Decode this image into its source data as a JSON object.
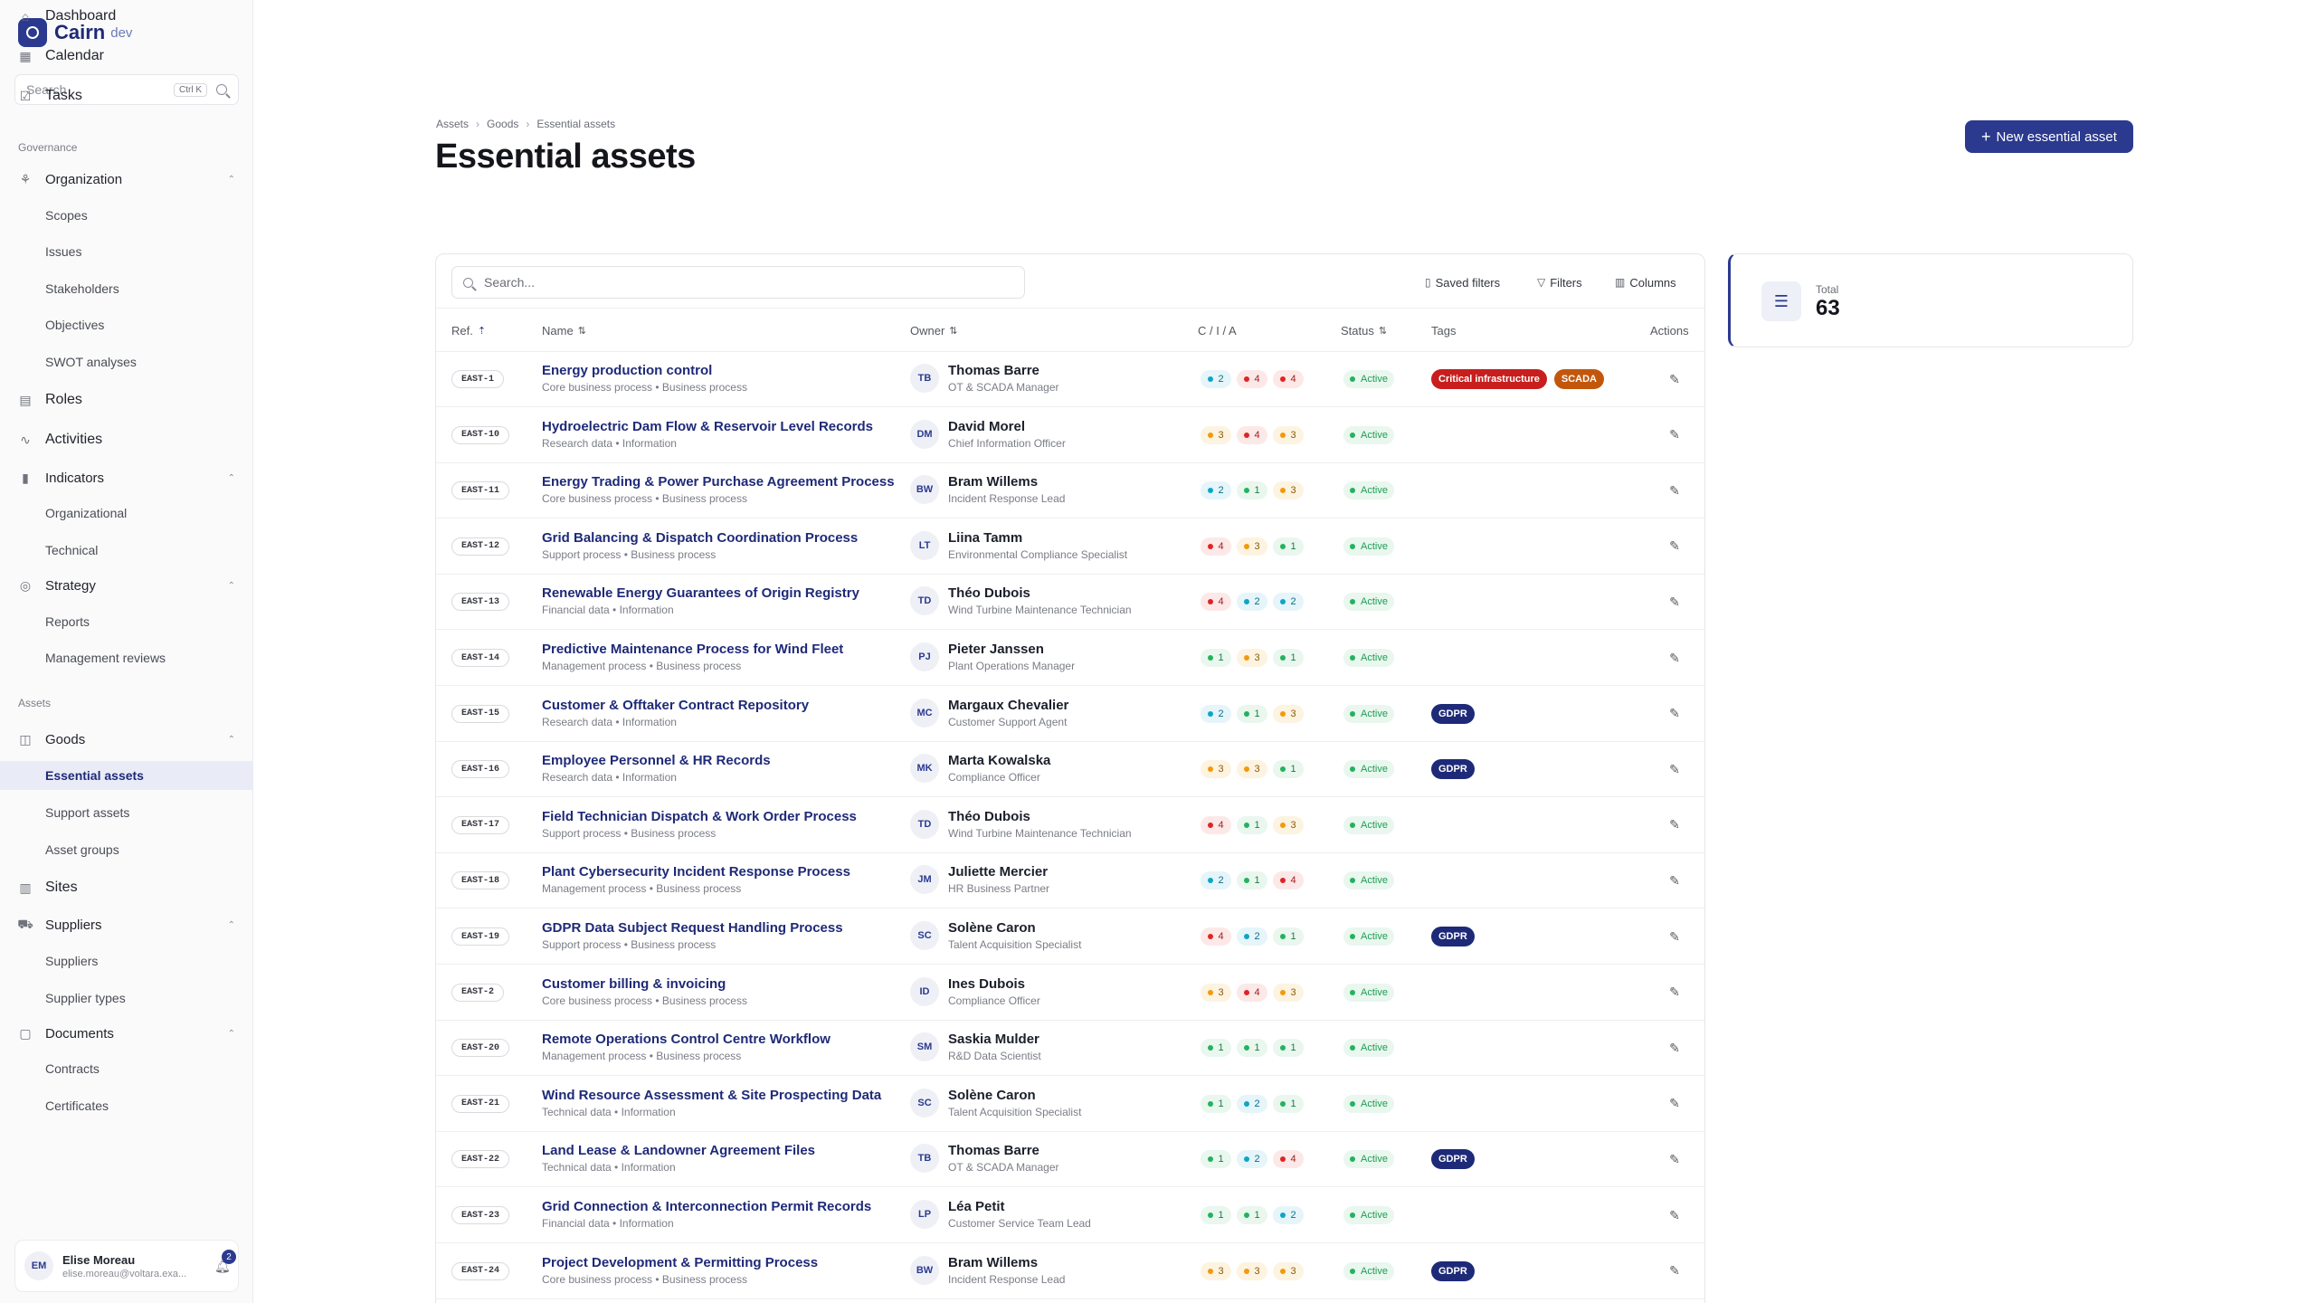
{
  "app": {
    "name": "Cairn",
    "env": "dev"
  },
  "sidebar": {
    "search_placeholder": "Search",
    "search_shortcut": "Ctrl K",
    "top_items": [
      {
        "label": "Dashboard",
        "icon": "dashboard-icon"
      },
      {
        "label": "Calendar",
        "icon": "calendar-icon"
      },
      {
        "label": "Tasks",
        "icon": "tasks-icon"
      }
    ],
    "sections": {
      "governance": "Governance",
      "assets": "Assets"
    },
    "governance": {
      "organization": "Organization",
      "organization_children": [
        "Scopes",
        "Issues",
        "Stakeholders",
        "Objectives",
        "SWOT analyses"
      ],
      "roles": "Roles",
      "activities": "Activities",
      "indicators": "Indicators",
      "indicators_children": [
        "Organizational",
        "Technical"
      ],
      "strategy": "Strategy",
      "strategy_children": [
        "Reports",
        "Management reviews"
      ]
    },
    "assets": {
      "goods": "Goods",
      "goods_children": [
        "Essential assets",
        "Support assets",
        "Asset groups"
      ],
      "sites": "Sites",
      "suppliers": "Suppliers",
      "suppliers_children": [
        "Suppliers",
        "Supplier types"
      ],
      "documents": "Documents",
      "documents_children": [
        "Contracts",
        "Certificates"
      ]
    },
    "user": {
      "initials": "EM",
      "name": "Elise Moreau",
      "email": "elise.moreau@voltara.exa...",
      "notifications": "2"
    }
  },
  "header": {
    "breadcrumb": [
      "Assets",
      "Goods",
      "Essential assets"
    ],
    "title": "Essential assets",
    "new_button": "New essential asset"
  },
  "toolbar": {
    "search_placeholder": "Search...",
    "saved_filters": "Saved filters",
    "filters": "Filters",
    "columns": "Columns"
  },
  "columns": {
    "ref": "Ref.",
    "name": "Name",
    "owner": "Owner",
    "cia": "C / I / A",
    "status": "Status",
    "tags": "Tags",
    "actions": "Actions"
  },
  "level_colors": {
    "1": {
      "dot": "#22b35e",
      "bg": "#e9f7ee",
      "fg": "#1f7a45"
    },
    "2": {
      "dot": "#0ea5c6",
      "bg": "#e5f5fa",
      "fg": "#0b6f86"
    },
    "3": {
      "dot": "#f29a0c",
      "bg": "#fdf3e1",
      "fg": "#8a5a06"
    },
    "4": {
      "dot": "#e02424",
      "bg": "#fde8e8",
      "fg": "#9b1c1c"
    }
  },
  "tag_colors": {
    "Critical infrastructure": "#c81e1e",
    "SCADA": "#c2570c",
    "GDPR": "#1e2a78"
  },
  "rows": [
    {
      "ref": "EAST-1",
      "name": "Energy production control",
      "sub": "Core business process • Business process",
      "initials": "TB",
      "owner": "Thomas Barre",
      "role": "OT & SCADA Manager",
      "cia": [
        2,
        4,
        4
      ],
      "status": "Active",
      "tags": [
        "Critical infrastructure",
        "SCADA"
      ]
    },
    {
      "ref": "EAST-10",
      "name": "Hydroelectric Dam Flow & Reservoir Level Records",
      "sub": "Research data • Information",
      "initials": "DM",
      "owner": "David Morel",
      "role": "Chief Information Officer",
      "cia": [
        3,
        4,
        3
      ],
      "status": "Active",
      "tags": []
    },
    {
      "ref": "EAST-11",
      "name": "Energy Trading & Power Purchase Agreement Process",
      "sub": "Core business process • Business process",
      "initials": "BW",
      "owner": "Bram Willems",
      "role": "Incident Response Lead",
      "cia": [
        2,
        1,
        3
      ],
      "status": "Active",
      "tags": []
    },
    {
      "ref": "EAST-12",
      "name": "Grid Balancing & Dispatch Coordination Process",
      "sub": "Support process • Business process",
      "initials": "LT",
      "owner": "Liina Tamm",
      "role": "Environmental Compliance Specialist",
      "cia": [
        4,
        3,
        1
      ],
      "status": "Active",
      "tags": []
    },
    {
      "ref": "EAST-13",
      "name": "Renewable Energy Guarantees of Origin Registry",
      "sub": "Financial data • Information",
      "initials": "TD",
      "owner": "Théo Dubois",
      "role": "Wind Turbine Maintenance Technician",
      "cia": [
        4,
        2,
        2
      ],
      "status": "Active",
      "tags": []
    },
    {
      "ref": "EAST-14",
      "name": "Predictive Maintenance Process for Wind Fleet",
      "sub": "Management process • Business process",
      "initials": "PJ",
      "owner": "Pieter Janssen",
      "role": "Plant Operations Manager",
      "cia": [
        1,
        3,
        1
      ],
      "status": "Active",
      "tags": []
    },
    {
      "ref": "EAST-15",
      "name": "Customer & Offtaker Contract Repository",
      "sub": "Research data • Information",
      "initials": "MC",
      "owner": "Margaux Chevalier",
      "role": "Customer Support Agent",
      "cia": [
        2,
        1,
        3
      ],
      "status": "Active",
      "tags": [
        "GDPR"
      ]
    },
    {
      "ref": "EAST-16",
      "name": "Employee Personnel & HR Records",
      "sub": "Research data • Information",
      "initials": "MK",
      "owner": "Marta Kowalska",
      "role": "Compliance Officer",
      "cia": [
        3,
        3,
        1
      ],
      "status": "Active",
      "tags": [
        "GDPR"
      ]
    },
    {
      "ref": "EAST-17",
      "name": "Field Technician Dispatch & Work Order Process",
      "sub": "Support process • Business process",
      "initials": "TD",
      "owner": "Théo Dubois",
      "role": "Wind Turbine Maintenance Technician",
      "cia": [
        4,
        1,
        3
      ],
      "status": "Active",
      "tags": []
    },
    {
      "ref": "EAST-18",
      "name": "Plant Cybersecurity Incident Response Process",
      "sub": "Management process • Business process",
      "initials": "JM",
      "owner": "Juliette Mercier",
      "role": "HR Business Partner",
      "cia": [
        2,
        1,
        4
      ],
      "status": "Active",
      "tags": []
    },
    {
      "ref": "EAST-19",
      "name": "GDPR Data Subject Request Handling Process",
      "sub": "Support process • Business process",
      "initials": "SC",
      "owner": "Solène Caron",
      "role": "Talent Acquisition Specialist",
      "cia": [
        4,
        2,
        1
      ],
      "status": "Active",
      "tags": [
        "GDPR"
      ]
    },
    {
      "ref": "EAST-2",
      "name": "Customer billing & invoicing",
      "sub": "Core business process • Business process",
      "initials": "ID",
      "owner": "Ines Dubois",
      "role": "Compliance Officer",
      "cia": [
        3,
        4,
        3
      ],
      "status": "Active",
      "tags": []
    },
    {
      "ref": "EAST-20",
      "name": "Remote Operations Control Centre Workflow",
      "sub": "Management process • Business process",
      "initials": "SM",
      "owner": "Saskia Mulder",
      "role": "R&D Data Scientist",
      "cia": [
        1,
        1,
        1
      ],
      "status": "Active",
      "tags": []
    },
    {
      "ref": "EAST-21",
      "name": "Wind Resource Assessment & Site Prospecting Data",
      "sub": "Technical data • Information",
      "initials": "SC",
      "owner": "Solène Caron",
      "role": "Talent Acquisition Specialist",
      "cia": [
        1,
        2,
        1
      ],
      "status": "Active",
      "tags": []
    },
    {
      "ref": "EAST-22",
      "name": "Land Lease & Landowner Agreement Files",
      "sub": "Technical data • Information",
      "initials": "TB",
      "owner": "Thomas Barre",
      "role": "OT & SCADA Manager",
      "cia": [
        1,
        2,
        4
      ],
      "status": "Active",
      "tags": [
        "GDPR"
      ]
    },
    {
      "ref": "EAST-23",
      "name": "Grid Connection & Interconnection Permit Records",
      "sub": "Financial data • Information",
      "initials": "LP",
      "owner": "Léa Petit",
      "role": "Customer Service Team Lead",
      "cia": [
        1,
        1,
        2
      ],
      "status": "Active",
      "tags": []
    },
    {
      "ref": "EAST-24",
      "name": "Project Development & Permitting Process",
      "sub": "Core business process • Business process",
      "initials": "BW",
      "owner": "Bram Willems",
      "role": "Incident Response Lead",
      "cia": [
        3,
        3,
        3
      ],
      "status": "Active",
      "tags": [
        "GDPR"
      ]
    }
  ],
  "total": {
    "label": "Total",
    "value": "63"
  }
}
